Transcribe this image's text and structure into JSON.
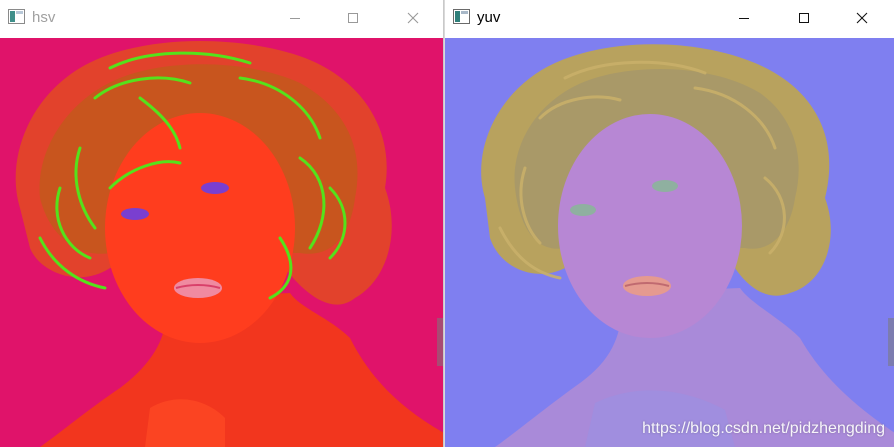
{
  "windows": [
    {
      "title": "hsv",
      "state": "inactive"
    },
    {
      "title": "yuv",
      "state": "active"
    }
  ],
  "controls": {
    "minimize": "minimize",
    "maximize": "maximize",
    "close": "close"
  },
  "watermark": "https://blog.csdn.net/pidzhengding",
  "colors": {
    "hsv_background": "#e0136a",
    "hsv_face": "#ff3d1e",
    "hsv_hair_highlight": "#55e21b",
    "yuv_background": "#7f7ff0",
    "yuv_face": "#b787d4",
    "yuv_hair": "#b8a25e"
  }
}
